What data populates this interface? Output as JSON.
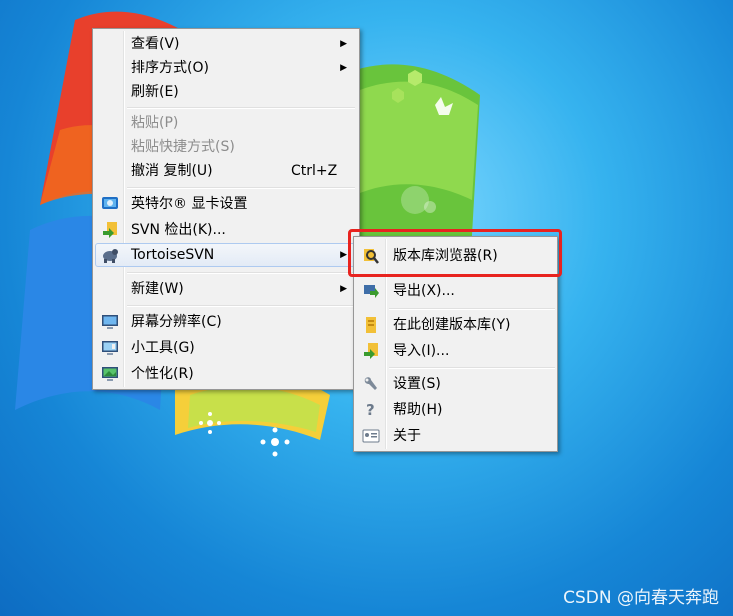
{
  "context_menu": {
    "items": [
      {
        "label": "查看(V)",
        "submenu": true
      },
      {
        "label": "排序方式(O)",
        "submenu": true
      },
      {
        "label": "刷新(E)"
      },
      {
        "label": "粘贴(P)",
        "disabled": true
      },
      {
        "label": "粘贴快捷方式(S)",
        "disabled": true
      },
      {
        "label": "撤消 复制(U)",
        "shortcut": "Ctrl+Z"
      },
      {
        "label": "英特尔® 显卡设置",
        "icon": "intel-graphics-icon"
      },
      {
        "label": "SVN 检出(K)...",
        "icon": "svn-checkout-icon"
      },
      {
        "label": "TortoiseSVN",
        "icon": "tortoisesvn-icon",
        "submenu": true
      },
      {
        "label": "新建(W)",
        "submenu": true
      },
      {
        "label": "屏幕分辨率(C)",
        "icon": "screen-resolution-icon"
      },
      {
        "label": "小工具(G)",
        "icon": "gadgets-icon"
      },
      {
        "label": "个性化(R)",
        "icon": "personalize-icon"
      }
    ]
  },
  "submenu": {
    "items": [
      {
        "label": "版本库浏览器(R)",
        "icon": "repo-browser-icon"
      },
      {
        "label": "导出(X)...",
        "icon": "export-icon"
      },
      {
        "label": "在此创建版本库(Y)",
        "icon": "create-repo-icon"
      },
      {
        "label": "导入(I)...",
        "icon": "import-icon"
      },
      {
        "label": "设置(S)",
        "icon": "settings-icon"
      },
      {
        "label": "帮助(H)",
        "icon": "help-icon"
      },
      {
        "label": "关于",
        "icon": "about-icon"
      }
    ]
  },
  "watermark": "CSDN @向春天奔跑",
  "colors": {
    "highlight_border": "#e8231f",
    "desktop": "#1e9ee0"
  }
}
